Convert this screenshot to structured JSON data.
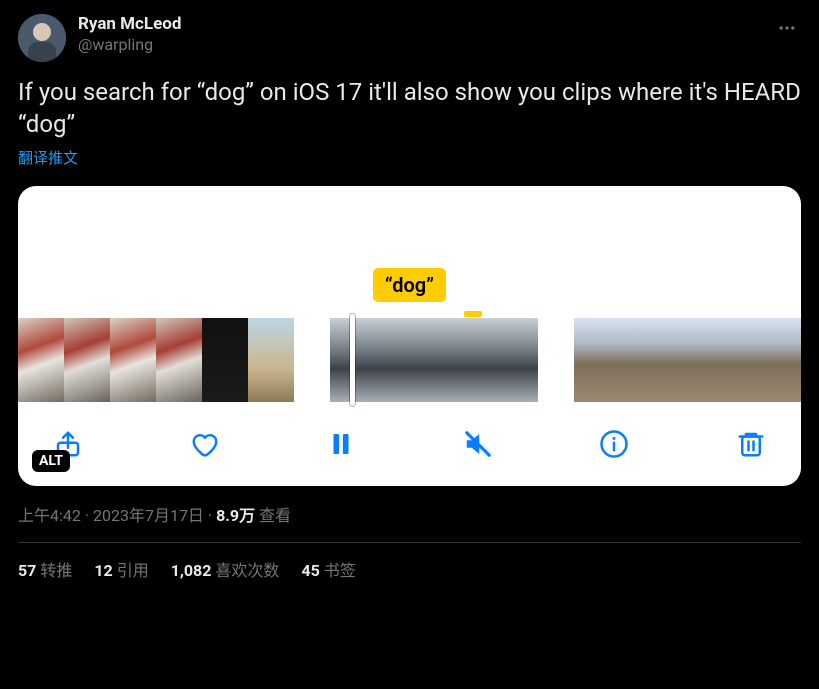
{
  "author": {
    "display_name": "Ryan McLeod",
    "handle": "@warpling"
  },
  "body": "If you search for “dog” on iOS 17 it'll also show you clips where it's HEARD “dog”",
  "translate_label": "翻译推文",
  "bubble_text": "“dog”",
  "alt_badge": "ALT",
  "meta": {
    "time": "上午4:42",
    "sep1": " · ",
    "date": "2023年7月17日",
    "sep2": " · ",
    "views_value": "8.9万",
    "views_label": " 查看"
  },
  "stats": {
    "retweet_count": "57",
    "retweet_label": "转推",
    "quote_count": "12",
    "quote_label": "引用",
    "like_count": "1,082",
    "like_label": "喜欢次数",
    "bookmark_count": "45",
    "bookmark_label": "书签"
  }
}
